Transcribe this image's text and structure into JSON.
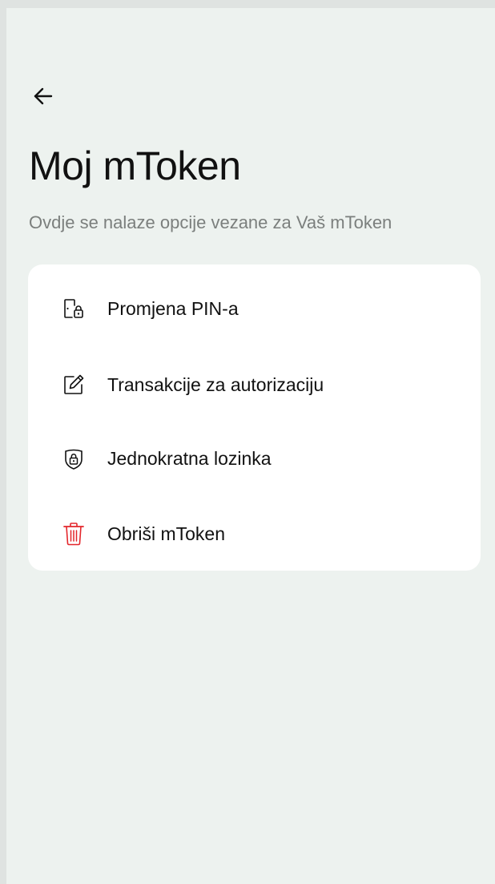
{
  "header": {
    "back_icon": "arrow-left-icon",
    "title": "Moj mToken",
    "subtitle": "Ovdje se nalaze opcije vezane za Vaš mToken"
  },
  "menu": {
    "items": [
      {
        "label": "Promjena PIN-a",
        "icon": "phone-lock-icon"
      },
      {
        "label": "Transakcije za autorizaciju",
        "icon": "edit-pen-icon"
      },
      {
        "label": "Jednokratna lozinka",
        "icon": "shield-lock-icon"
      },
      {
        "label": "Obriši mToken",
        "icon": "trash-icon",
        "color": "#e3262b"
      }
    ]
  },
  "colors": {
    "background": "#edf2ef",
    "card": "#ffffff",
    "text": "#111111",
    "subtitle": "#7b7f7d",
    "danger": "#e3262b"
  }
}
